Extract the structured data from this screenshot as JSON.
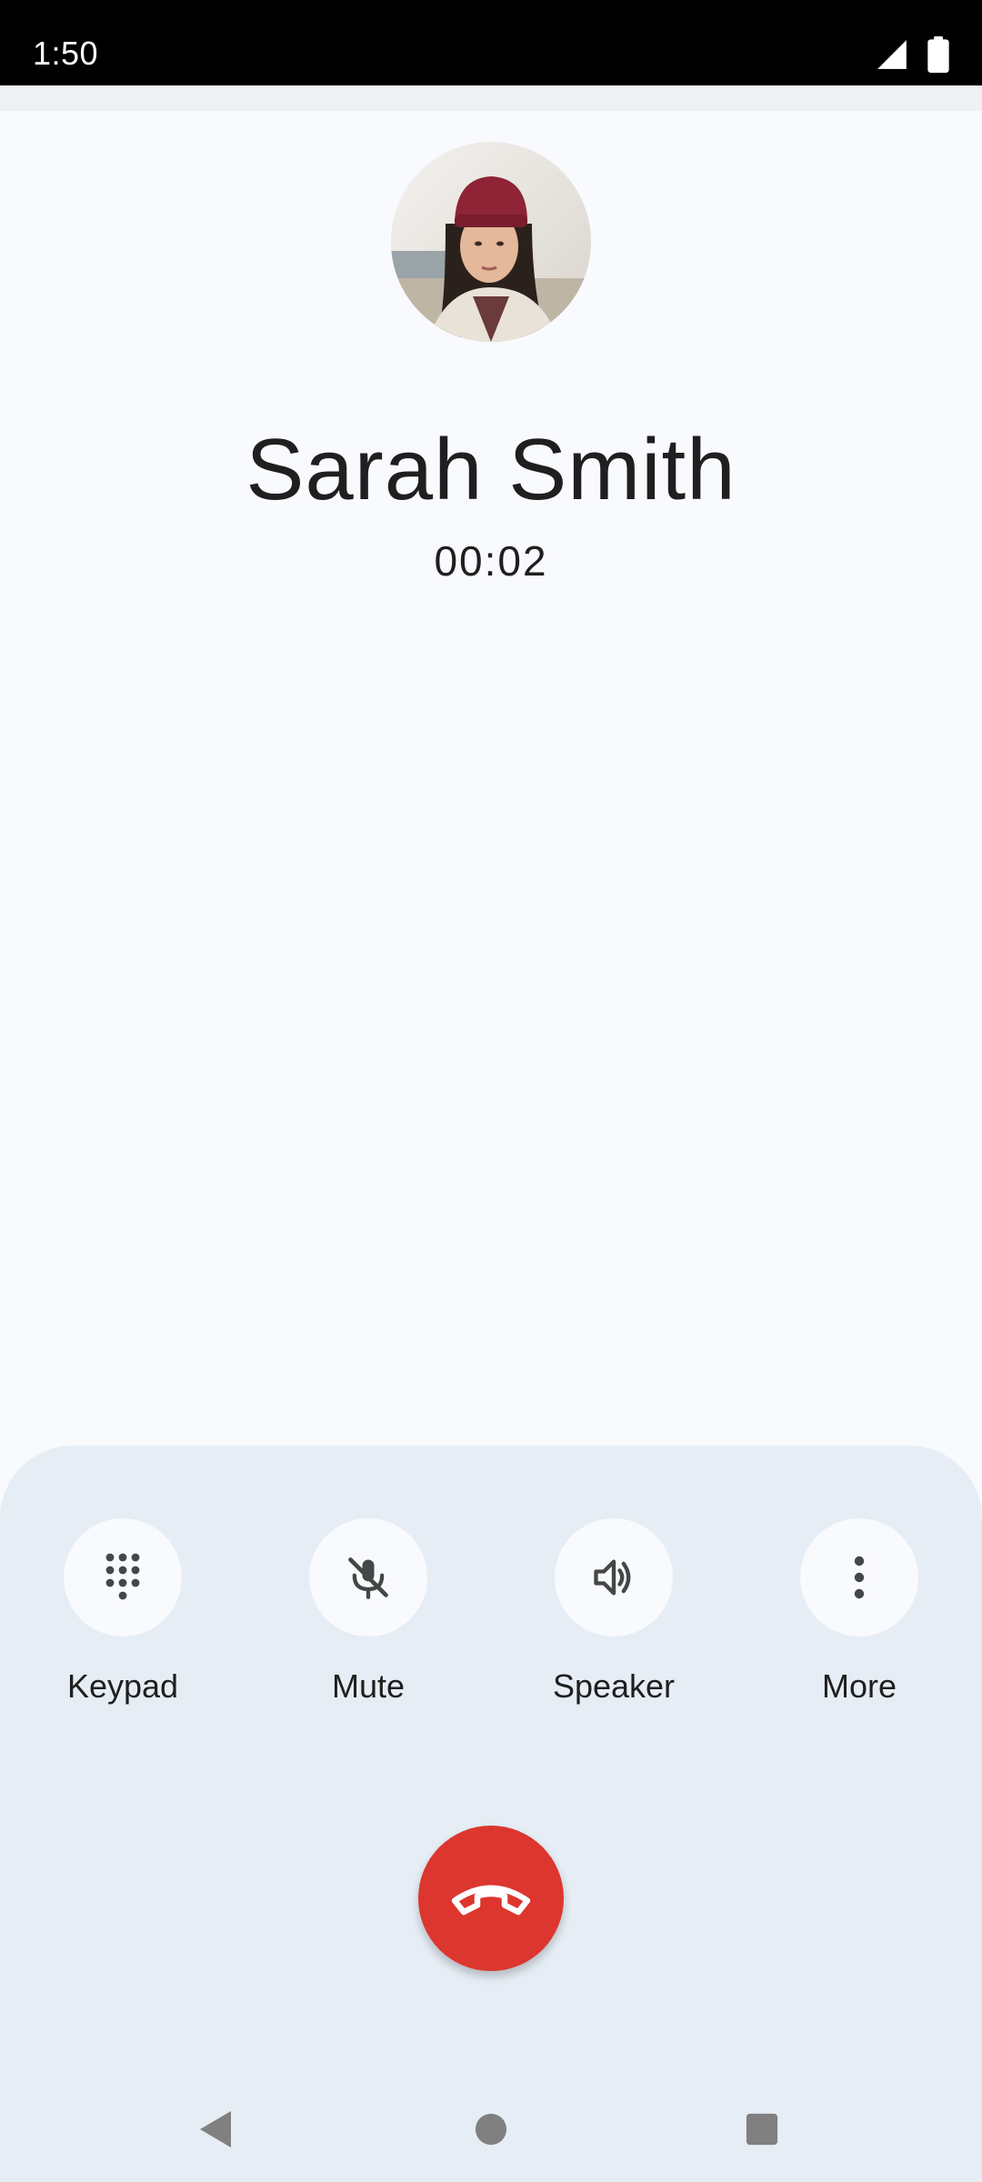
{
  "status_bar": {
    "time": "1:50",
    "icons": [
      "cell-signal-icon",
      "battery-icon"
    ]
  },
  "contact": {
    "name": "Sarah Smith",
    "call_duration": "00:02",
    "avatar": "contact-photo"
  },
  "controls": [
    {
      "label": "Keypad",
      "icon": "dialpad-icon"
    },
    {
      "label": "Mute",
      "icon": "mic-off-icon"
    },
    {
      "label": "Speaker",
      "icon": "speaker-icon"
    },
    {
      "label": "More",
      "icon": "more-vert-icon"
    }
  ],
  "end_call": {
    "icon": "call-end-icon",
    "color": "#dc362e"
  },
  "nav": [
    "back-icon",
    "home-icon",
    "recents-icon"
  ],
  "colors": {
    "background": "#f8fafd",
    "sheet": "#e6edf5",
    "end_call": "#dc362e"
  }
}
